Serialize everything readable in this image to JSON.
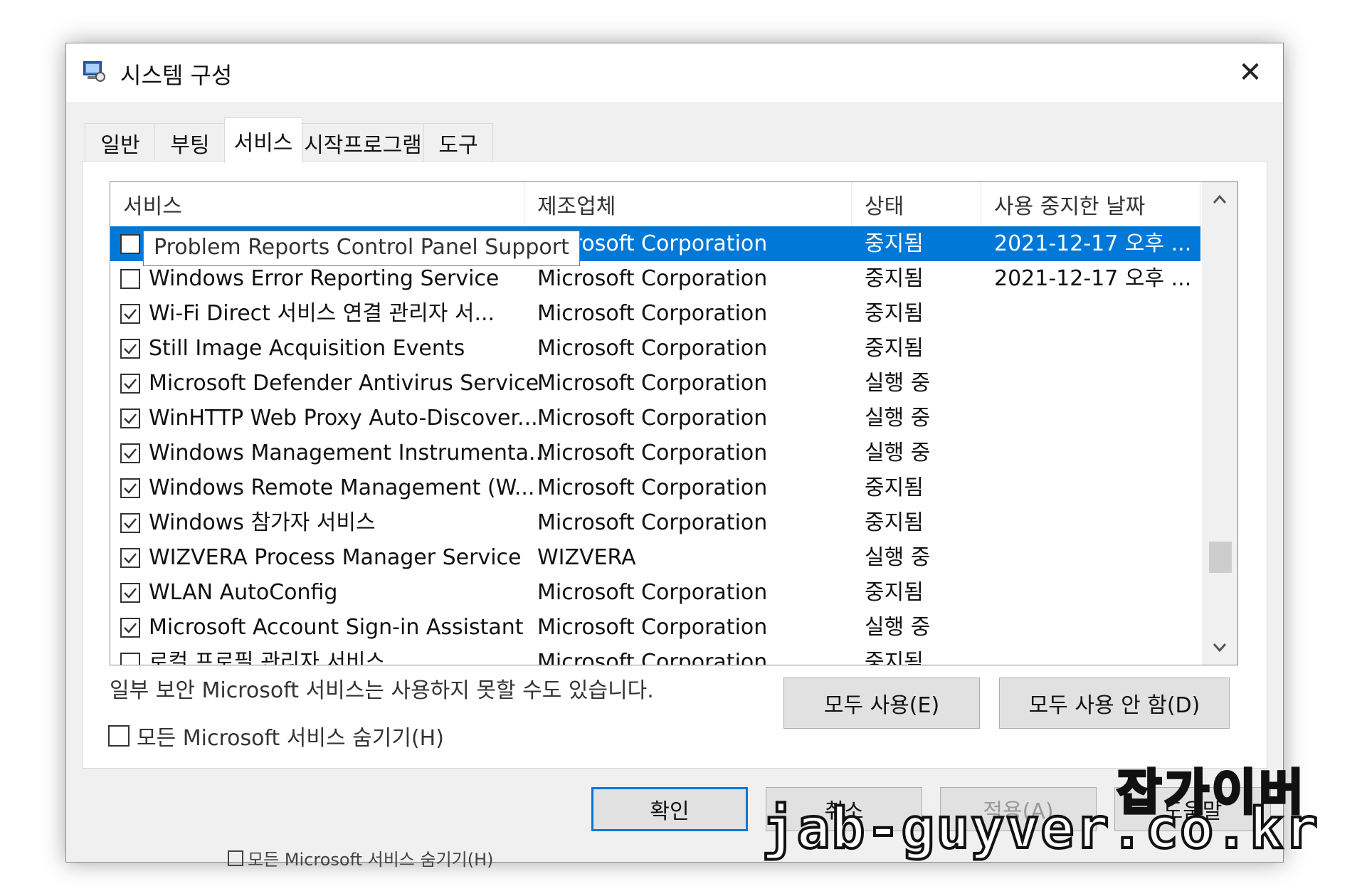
{
  "window": {
    "title": "시스템 구성",
    "close_glyph": "✕"
  },
  "tabs": [
    {
      "label": "일반"
    },
    {
      "label": "부팅"
    },
    {
      "label": "서비스",
      "active": true
    },
    {
      "label": "시작프로그램"
    },
    {
      "label": "도구"
    }
  ],
  "list": {
    "columns": [
      "서비스",
      "제조업체",
      "상태",
      "사용 중지한 날짜"
    ],
    "tooltip": "Problem Reports Control Panel Support",
    "rows": [
      {
        "service": "Problem Reports Control Panel Support",
        "manufacturer": "Microsoft Corporation",
        "status": "중지됨",
        "date": "2021-12-17 오후 ...",
        "checked": false,
        "selected": true
      },
      {
        "service": "Windows Error Reporting Service",
        "manufacturer": "Microsoft Corporation",
        "status": "중지됨",
        "date": "2021-12-17 오후 ...",
        "checked": false
      },
      {
        "service": "Wi-Fi Direct 서비스 연결 관리자 서...",
        "manufacturer": "Microsoft Corporation",
        "status": "중지됨",
        "date": "",
        "checked": true
      },
      {
        "service": "Still Image Acquisition Events",
        "manufacturer": "Microsoft Corporation",
        "status": "중지됨",
        "date": "",
        "checked": true
      },
      {
        "service": "Microsoft Defender Antivirus Service",
        "manufacturer": "Microsoft Corporation",
        "status": "실행 중",
        "date": "",
        "checked": true
      },
      {
        "service": "WinHTTP Web Proxy Auto-Discover...",
        "manufacturer": "Microsoft Corporation",
        "status": "실행 중",
        "date": "",
        "checked": true
      },
      {
        "service": "Windows Management Instrumenta...",
        "manufacturer": "Microsoft Corporation",
        "status": "실행 중",
        "date": "",
        "checked": true
      },
      {
        "service": "Windows Remote Management (W...",
        "manufacturer": "Microsoft Corporation",
        "status": "중지됨",
        "date": "",
        "checked": true
      },
      {
        "service": "Windows 참가자 서비스",
        "manufacturer": "Microsoft Corporation",
        "status": "중지됨",
        "date": "",
        "checked": true
      },
      {
        "service": "WIZVERA Process Manager Service",
        "manufacturer": "WIZVERA",
        "status": "실행 중",
        "date": "",
        "checked": true
      },
      {
        "service": "WLAN AutoConfig",
        "manufacturer": "Microsoft Corporation",
        "status": "중지됨",
        "date": "",
        "checked": true
      },
      {
        "service": "Microsoft Account Sign-in Assistant",
        "manufacturer": "Microsoft Corporation",
        "status": "실행 중",
        "date": "",
        "checked": true
      },
      {
        "service": "로컬 프로필 관리자 서비스",
        "manufacturer": "Microsoft Corporation",
        "status": "중지됨",
        "date": "",
        "checked": false
      }
    ]
  },
  "note": "일부 보안 Microsoft 서비스는 사용하지 못할 수도 있습니다.",
  "hide_ms_label": "모든 Microsoft 서비스 숨기기(H)",
  "buttons": {
    "enable_all": "모두 사용(E)",
    "disable_all": "모두 사용 안 함(D)",
    "ok": "확인",
    "cancel": "취소",
    "apply": "적용(A)",
    "help": "도움말"
  },
  "underlay_hint": "모든 Microsoft 서비스 숨기기(H)",
  "watermark": {
    "name": "잡가이버",
    "url": "jab-guyver.co.kr"
  },
  "colors": {
    "selection": "#0078d7",
    "dialog_bg": "#f0f0f0"
  }
}
